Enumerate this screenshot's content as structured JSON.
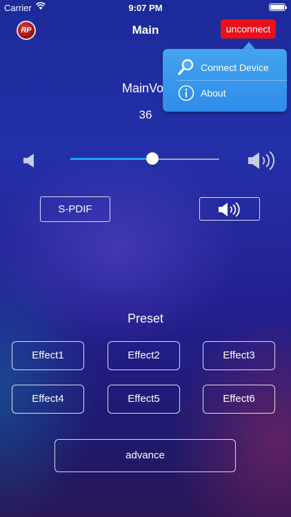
{
  "status_bar": {
    "carrier": "Carrier",
    "time": "9:07 PM"
  },
  "nav": {
    "logo_text": "RP",
    "title": "Main",
    "unconnect_label": "unconnect"
  },
  "popup_menu": {
    "items": [
      {
        "label": "Connect Device",
        "icon": "search-icon"
      },
      {
        "label": "About",
        "icon": "info-icon"
      }
    ]
  },
  "main_volume": {
    "label": "MainVo",
    "value": "36",
    "level": 0.55
  },
  "controls": {
    "spdif_label": "S-PDIF",
    "mute_icon": "speaker-loud-icon"
  },
  "preset": {
    "label": "Preset",
    "effects": [
      "Effect1",
      "Effect2",
      "Effect3",
      "Effect4",
      "Effect5",
      "Effect6"
    ]
  },
  "advance_label": "advance",
  "colors": {
    "accent": "#1ba0ff",
    "unconnect": "#e8101a",
    "popup": "#3b98ec"
  }
}
